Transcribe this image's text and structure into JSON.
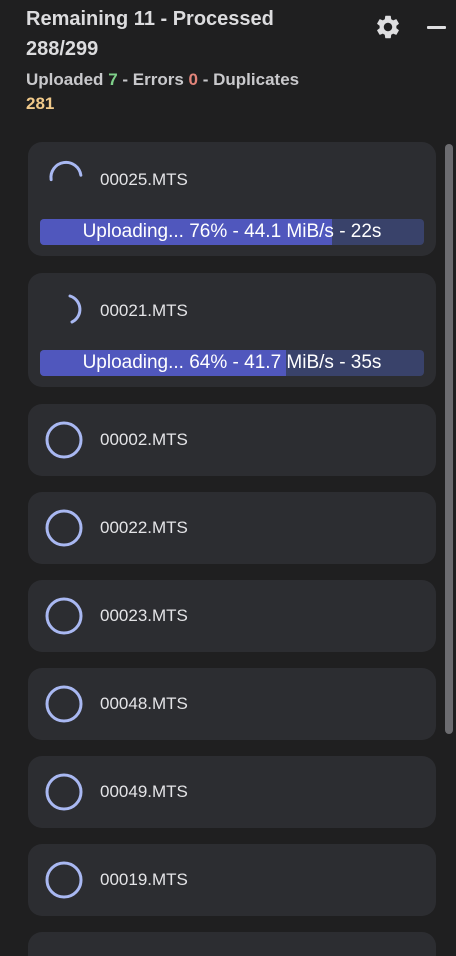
{
  "header": {
    "title_line1": "Remaining 11 - Processed",
    "title_line2": "288/299",
    "uploaded_label": "Uploaded",
    "uploaded_count": "7",
    "errors_label": "- Errors",
    "errors_count": "0",
    "duplicates_label": "- Duplicates",
    "duplicates_count": "281"
  },
  "icons": {
    "settings": "gear-icon",
    "minimize": "minimize-icon"
  },
  "colors": {
    "uploaded": "#7fd08a",
    "errors": "#e2847a",
    "duplicates": "#f0c98a",
    "progress_fill": "#5057bd",
    "progress_track": "#39426a",
    "ring": "#a9b8f2"
  },
  "uploads": [
    {
      "filename": "00025.MTS",
      "status_text": "Uploading... 76% - 44.1 MiB/s - 22s",
      "progress": 0.76
    },
    {
      "filename": "00021.MTS",
      "status_text": "Uploading... 64% - 41.7 MiB/s - 35s",
      "progress": 0.64
    }
  ],
  "queue": [
    {
      "filename": "00002.MTS"
    },
    {
      "filename": "00022.MTS"
    },
    {
      "filename": "00023.MTS"
    },
    {
      "filename": "00048.MTS"
    },
    {
      "filename": "00049.MTS"
    },
    {
      "filename": "00019.MTS"
    }
  ]
}
